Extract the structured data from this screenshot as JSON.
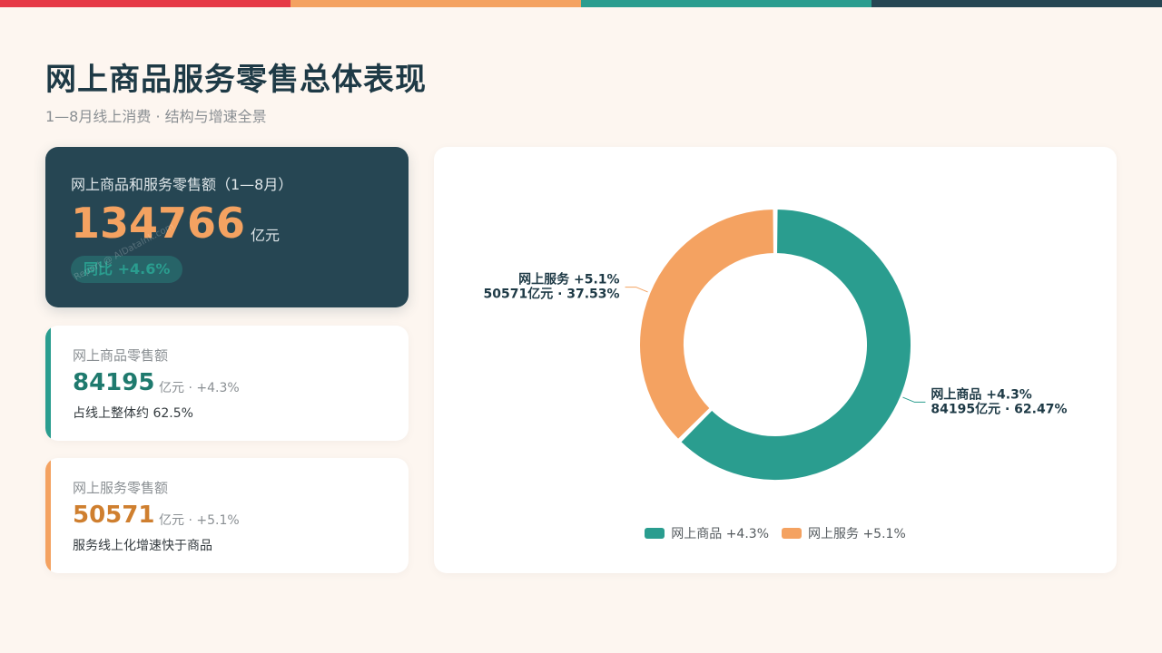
{
  "colors": {
    "topbar": [
      "#e63946",
      "#f4a261",
      "#2a9d8f",
      "#264653"
    ],
    "goods": "#2a9d8f",
    "services": "#f4a261",
    "goods_value": "#1f7a6e",
    "services_value": "#cf7f2f"
  },
  "header": {
    "title": "网上商品服务零售总体表现",
    "subtitle": "1—8月线上消费 · 结构与增速全景"
  },
  "hero": {
    "label": "网上商品和服务零售额（1—8月）",
    "value": "134766",
    "unit": "亿元",
    "badge": "同比 +4.6%",
    "watermark": "Report @ AIDataInk.com"
  },
  "cards": [
    {
      "label": "网上商品零售额",
      "value": "84195",
      "meta": "亿元 · +4.3%",
      "note": "占线上整体约 62.5%"
    },
    {
      "label": "网上服务零售额",
      "value": "50571",
      "meta": "亿元 · +5.1%",
      "note": "服务线上化增速快于商品"
    }
  ],
  "chart_data": {
    "type": "pie",
    "subtype": "donut",
    "unit": "亿元",
    "slices": [
      {
        "name": "网上商品 +4.3%",
        "label_line1": "网上商品 +4.3%",
        "label_line2": "84195亿元 · 62.47%",
        "value": 84195,
        "percent": 62.47,
        "color": "#2a9d8f"
      },
      {
        "name": "网上服务 +5.1%",
        "label_line1": "网上服务 +5.1%",
        "label_line2": "50571亿元 · 37.53%",
        "value": 50571,
        "percent": 37.53,
        "color": "#f4a261"
      }
    ],
    "legend": [
      "网上商品 +4.3%",
      "网上服务 +5.1%"
    ],
    "legend_position": "bottom-center"
  }
}
